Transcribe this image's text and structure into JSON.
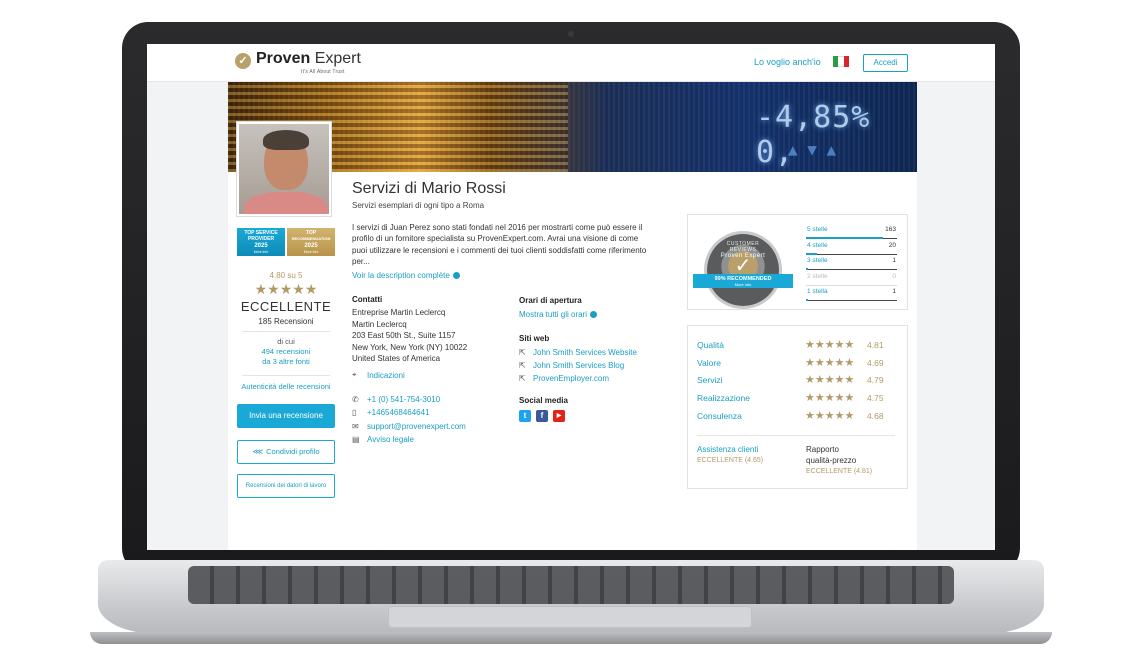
{
  "header": {
    "logo_mark": "✓",
    "logo_bold": "Proven",
    "logo_light": " Expert",
    "tagline": "It's All About Trust",
    "cta": "Lo voglio anch'io",
    "login": "Accedi",
    "flag_colors": [
      "#2e9a47",
      "#ffffff",
      "#d8262e"
    ]
  },
  "banner": {
    "ticker": "-4,85% 0,",
    "ticker2": "▲ ▼ ▲"
  },
  "profile": {
    "name": "Servizi di Mario Rossi",
    "subtitle": "Servizi esemplari di ogni tipo a Roma",
    "description": "I servizi di Juan Perez sono stati fondati nel 2016 per mostrarti come può essere il profilo di un fornitore specialista su ProvenExpert.com. Avrai una visione di come puoi utilizzare le recensioni e i commenti dei tuoi clienti soddisfatti come riferimento per...",
    "read_more": "Voir la description complète"
  },
  "awards": [
    {
      "line1": "TOP SERVICE",
      "line2": "PROVIDER",
      "year": "2025",
      "more": "More info"
    },
    {
      "line1": "TOP",
      "line2": "RECOMMENDATION",
      "year": "2025",
      "more": "More info"
    }
  ],
  "rating": {
    "score_text": "4.80 su 5",
    "stars": "★★★★★",
    "label": "ECCELLENTE",
    "reviews": "185 Recensioni",
    "di_cui": "di cui",
    "from_reviews": "494 recensioni",
    "from_sources": "da 3 altre fonti",
    "authenticity": "Autenticità delle recensioni",
    "cta_review": "Invia una recensione",
    "cta_share": "Condividi profilo",
    "cta_employer": "Recensioni dei datori di lavoro"
  },
  "contacts": {
    "heading": "Contatti",
    "address": [
      "Entreprise Martin Leclercq",
      "Martin Leclercq",
      "203 East 50th St., Suite 1157",
      "New York, New York (NY) 10022",
      "United States of America"
    ],
    "directions": "Indicazioni",
    "phone": "+1 (0) 541-754-3010",
    "mobile": "+1465468464641",
    "email": "support@provenexpert.com",
    "legal": "Avviso legale"
  },
  "hours": {
    "heading": "Orari di apertura",
    "link": "Mostra tutti gli orari"
  },
  "websites": {
    "heading": "Siti web",
    "items": [
      "John Smith Services Website",
      "John Smith Services Blog",
      "ProvenEmployer.com"
    ]
  },
  "social": {
    "heading": "Social media",
    "items": [
      {
        "glyph": "t",
        "color": "#1da1f2"
      },
      {
        "glyph": "f",
        "color": "#3b5998"
      },
      {
        "glyph": "▶",
        "color": "#e62117"
      }
    ]
  },
  "seal": {
    "arc": "CUSTOMER REVIEWS",
    "brand": "Proven Expert",
    "band": "99% RECOMMENDED",
    "band_sub": "More info",
    "check": "✓"
  },
  "distribution": [
    {
      "label": "5 stelle",
      "count": "163",
      "share": 0.85,
      "dim": false
    },
    {
      "label": "4 stelle",
      "count": "20",
      "share": 0.12,
      "dim": false
    },
    {
      "label": "3 stelle",
      "count": "1",
      "share": 0.02,
      "dim": false
    },
    {
      "label": "2 stelle",
      "count": "0",
      "share": 0,
      "dim": true
    },
    {
      "label": "1 stella",
      "count": "1",
      "share": 0.02,
      "dim": false
    }
  ],
  "criteria": [
    {
      "label": "Qualità",
      "stars": "★★★★★",
      "value": "4.81"
    },
    {
      "label": "Valore",
      "stars": "★★★★★",
      "value": "4.69"
    },
    {
      "label": "Servizi",
      "stars": "★★★★★",
      "value": "4.79"
    },
    {
      "label": "Realizzazione",
      "stars": "★★★★★",
      "value": "4.75"
    },
    {
      "label": "Consulenza",
      "stars": "★★★★★",
      "value": "4.68"
    }
  ],
  "sub_ratings": {
    "a_label": "Assistenza clienti",
    "a_value": "ECCELLENTE (4.65)",
    "b_label1": "Rapporto",
    "b_label2": "qualità-prezzo",
    "b_value": "ECCELLENTE (4.81)"
  },
  "icons": {
    "pin": "⌖",
    "phone": "✆",
    "mobile": "▯",
    "mail": "✉",
    "doc": "▤",
    "ext": "⇱",
    "share": "⋘"
  },
  "colors": {
    "accent": "#1aa9d6",
    "gold": "#b29a67",
    "text": "#333333"
  }
}
